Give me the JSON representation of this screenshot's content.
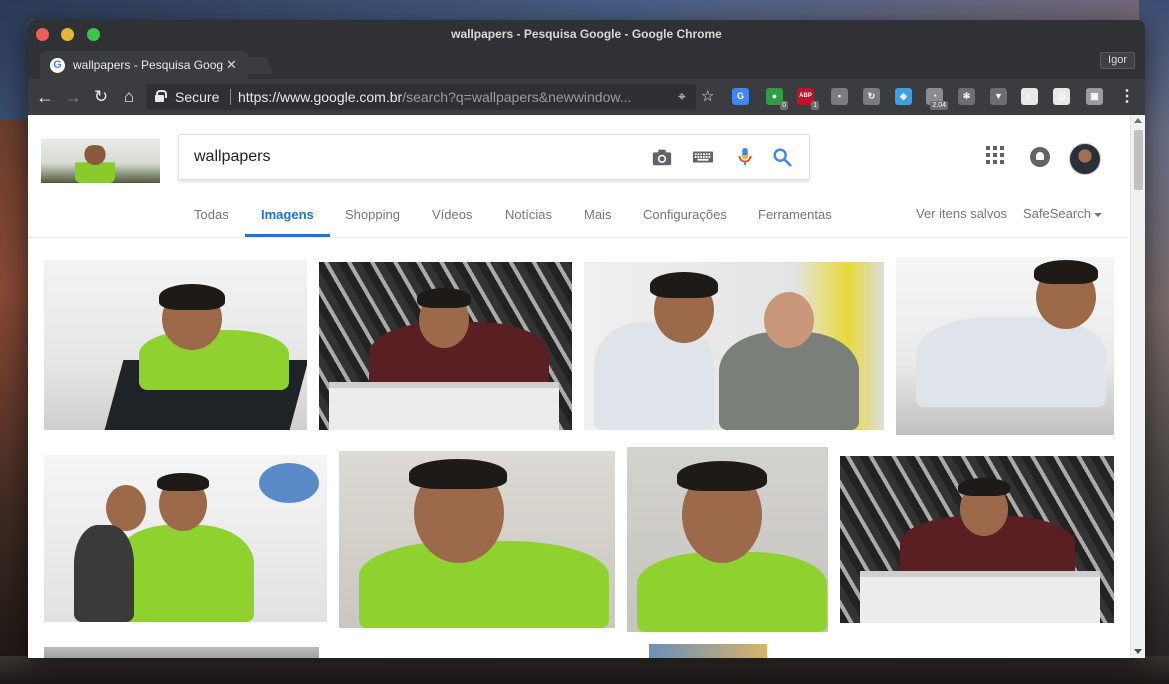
{
  "window": {
    "title": "wallpapers - Pesquisa Google - Google Chrome",
    "profile_name": "Igor"
  },
  "tab": {
    "title": "wallpapers - Pesquisa Google",
    "favicon": "G"
  },
  "toolbar": {
    "secure_label": "Secure",
    "url_host": "https://www.google.com.br",
    "url_rest": "/search?q=wallpapers&newwindow...",
    "extensions": [
      {
        "name": "google-translate-icon",
        "color": "#4285f4",
        "glyph": "G",
        "badge": ""
      },
      {
        "name": "extension-green-icon",
        "color": "#2e9e44",
        "glyph": "●",
        "badge": "0"
      },
      {
        "name": "adblock-plus-icon",
        "color": "#c70d2c",
        "glyph": "ABP",
        "badge": "1"
      },
      {
        "name": "chat-icon",
        "color": "#7a7c80",
        "glyph": "▪",
        "badge": ""
      },
      {
        "name": "sync-icon",
        "color": "#7a7c80",
        "glyph": "↻",
        "badge": ""
      },
      {
        "name": "diamond-icon",
        "color": "#3aa0e8",
        "glyph": "◆",
        "badge": ""
      },
      {
        "name": "speed-icon",
        "color": "#8a8c90",
        "glyph": "◔",
        "badge": "2.04"
      },
      {
        "name": "react-icon",
        "color": "#6c6e72",
        "glyph": "✻",
        "badge": ""
      },
      {
        "name": "vue-icon",
        "color": "#6c6e72",
        "glyph": "▼",
        "badge": ""
      },
      {
        "name": "circle-ext-icon",
        "color": "#e8e8e8",
        "glyph": "◐",
        "badge": ""
      },
      {
        "name": "target-ext-icon",
        "color": "#e8e8e8",
        "glyph": "◎",
        "badge": ""
      },
      {
        "name": "screenshot-icon",
        "color": "#9a9ca0",
        "glyph": "▣",
        "badge": ""
      }
    ]
  },
  "search": {
    "query": "wallpapers"
  },
  "tabs": [
    {
      "label": "Todas"
    },
    {
      "label": "Imagens"
    },
    {
      "label": "Shopping"
    },
    {
      "label": "Vídeos"
    },
    {
      "label": "Notícias"
    },
    {
      "label": "Mais"
    },
    {
      "label": "Configurações"
    },
    {
      "label": "Ferramentas"
    }
  ],
  "tabs_right": {
    "saved": "Ver itens salvos",
    "safesearch": "SafeSearch"
  },
  "colors": {
    "accent": "#1a73e8",
    "shirt_green": "#8fd12e"
  }
}
